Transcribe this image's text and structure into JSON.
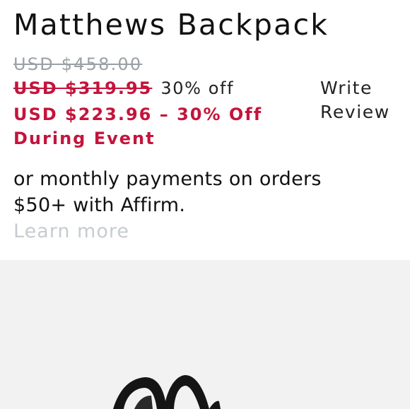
{
  "product": {
    "title": "Matthews Backpack",
    "original_price": "USD $458.00",
    "sale_price": "USD $319.95",
    "discount_label": "30% off",
    "event_price": "USD $223.96 – 30% Off During Event",
    "review_link": "Write Review",
    "affirm_text": "or monthly payments on orders $50+ with Affirm.",
    "learn_more": "Learn more"
  },
  "colors": {
    "accent_red": "#c4143c",
    "muted_gray": "#9aa1a6",
    "image_background": "#f2f2f2"
  }
}
